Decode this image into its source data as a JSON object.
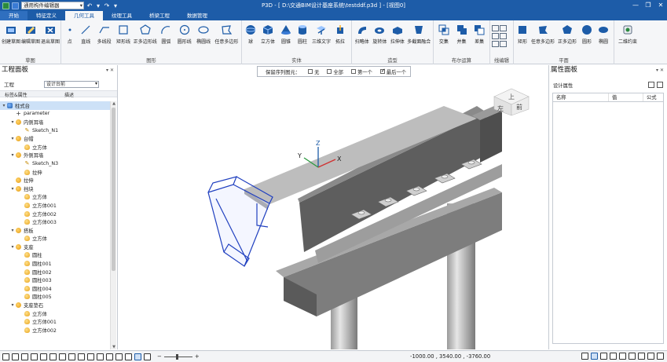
{
  "titlebar": {
    "mode_select": "通用构件编辑器",
    "title": "P3D - [ D:\\交通BIM设计基座系统\\testddf.p3d ] - [视图0]",
    "win_controls": [
      "—",
      "❐",
      "✕"
    ]
  },
  "tabs": [
    "开始",
    "特征定义",
    "几何工具",
    "纹理工具",
    "桥梁工程",
    "数据管理"
  ],
  "active_tab": "几何工具",
  "ribbon": {
    "groups": [
      {
        "label": "草图",
        "buttons": [
          "创建草图",
          "编辑草图",
          "退出草图"
        ]
      },
      {
        "label": "图形",
        "buttons": [
          "点",
          "直线",
          "多线段",
          "矩形线",
          "正多边形线",
          "圆弧",
          "圆形线",
          "椭圆线",
          "任意多边形"
        ]
      },
      {
        "label": "实体",
        "buttons": [
          "球",
          "立方体",
          "圆锥",
          "圆柱",
          "三维文字",
          "拓拉"
        ]
      },
      {
        "label": "造型",
        "buttons": [
          "扫略体",
          "旋转体",
          "拉伸体",
          "多截面融合"
        ]
      },
      {
        "label": "布尔运算",
        "buttons": [
          "交集",
          "并集",
          "差集"
        ]
      },
      {
        "label": "线编辑",
        "buttons": []
      },
      {
        "label": "平面",
        "buttons": [
          "矩形",
          "任意多边形",
          "正多边形",
          "圆形",
          "椭圆"
        ]
      },
      {
        "label": "",
        "buttons": [
          "二维约束"
        ]
      }
    ]
  },
  "options_popup": {
    "label": "保留序列图元：",
    "options": [
      {
        "label": "无",
        "checked": false
      },
      {
        "label": "全部",
        "checked": false
      },
      {
        "label": "第一个",
        "checked": false
      },
      {
        "label": "最后一个",
        "checked": true
      }
    ]
  },
  "left_panel": {
    "title": "工程面板",
    "project_label": "工程",
    "project_value": "设计台前",
    "col_name": "标签&属性",
    "col_desc": "描述",
    "tree": [
      {
        "label": "柱式台",
        "level": 0,
        "icon": "root",
        "exp": "▾",
        "selected": true
      },
      {
        "label": "parameter",
        "level": 1,
        "icon": "param",
        "exp": ""
      },
      {
        "label": "内侧耳墙",
        "level": 1,
        "icon": "part",
        "exp": "▾"
      },
      {
        "label": "Sketch_N1",
        "level": 2,
        "icon": "sketch",
        "exp": ""
      },
      {
        "label": "台帽",
        "level": 1,
        "icon": "part",
        "exp": "▾"
      },
      {
        "label": "立方体",
        "level": 2,
        "icon": "solid",
        "exp": ""
      },
      {
        "label": "外侧耳墙",
        "level": 1,
        "icon": "part",
        "exp": "▾"
      },
      {
        "label": "Sketch_N3",
        "level": 2,
        "icon": "sketch",
        "exp": ""
      },
      {
        "label": "拉伸",
        "level": 2,
        "icon": "solid",
        "exp": ""
      },
      {
        "label": "拉伸",
        "level": 1,
        "icon": "part",
        "exp": ""
      },
      {
        "label": "挡块",
        "level": 1,
        "icon": "part",
        "exp": "▾"
      },
      {
        "label": "立方体",
        "level": 2,
        "icon": "solid",
        "exp": ""
      },
      {
        "label": "立方体001",
        "level": 2,
        "icon": "solid",
        "exp": ""
      },
      {
        "label": "立方体002",
        "level": 2,
        "icon": "solid",
        "exp": ""
      },
      {
        "label": "立方体003",
        "level": 2,
        "icon": "solid",
        "exp": ""
      },
      {
        "label": "搭板",
        "level": 1,
        "icon": "part",
        "exp": "▾"
      },
      {
        "label": "立方体",
        "level": 2,
        "icon": "solid",
        "exp": ""
      },
      {
        "label": "支座",
        "level": 1,
        "icon": "part",
        "exp": "▾"
      },
      {
        "label": "圆柱",
        "level": 2,
        "icon": "solid",
        "exp": ""
      },
      {
        "label": "圆柱001",
        "level": 2,
        "icon": "solid",
        "exp": ""
      },
      {
        "label": "圆柱002",
        "level": 2,
        "icon": "solid",
        "exp": ""
      },
      {
        "label": "圆柱003",
        "level": 2,
        "icon": "solid",
        "exp": ""
      },
      {
        "label": "圆柱004",
        "level": 2,
        "icon": "solid",
        "exp": ""
      },
      {
        "label": "圆柱005",
        "level": 2,
        "icon": "solid",
        "exp": ""
      },
      {
        "label": "支座垫石",
        "level": 1,
        "icon": "part",
        "exp": "▾"
      },
      {
        "label": "立方体",
        "level": 2,
        "icon": "solid",
        "exp": ""
      },
      {
        "label": "立方体001",
        "level": 2,
        "icon": "solid",
        "exp": ""
      },
      {
        "label": "立方体002",
        "level": 2,
        "icon": "solid",
        "exp": ""
      }
    ]
  },
  "viewcube": {
    "top": "上",
    "left": "左",
    "front": "前"
  },
  "axes": {
    "x": "X",
    "y": "Y",
    "z": "Z"
  },
  "right_panel": {
    "title": "属性面板",
    "sub_title": "设计属性",
    "columns": [
      "名称",
      "值",
      "公式"
    ]
  },
  "statusbar": {
    "coords": "-1000.00 , 3540.00 , -3760.00",
    "zoom_minus": "−",
    "zoom_plus": "+"
  },
  "colors": {
    "brand": "#1d5ca8",
    "selection": "#1f3fbf"
  }
}
